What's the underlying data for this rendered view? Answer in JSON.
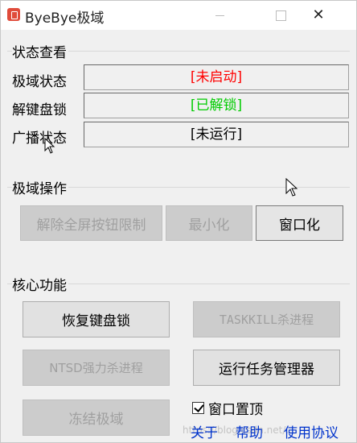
{
  "window": {
    "title": "ByeBye极域",
    "close_glyph": "✕"
  },
  "status_group": {
    "title": "状态查看",
    "rows": [
      {
        "label": "极域状态",
        "value": "[未启动]",
        "color": "#ff0000"
      },
      {
        "label": "解键盘锁",
        "value": "[已解锁]",
        "color": "#00cc00"
      },
      {
        "label": "广播状态",
        "value": "[未运行]",
        "color": "#000000"
      }
    ]
  },
  "ops_group": {
    "title": "极域操作",
    "buttons": [
      {
        "label": "解除全屏按钮限制",
        "enabled": false
      },
      {
        "label": "最小化",
        "enabled": false
      },
      {
        "label": "窗口化",
        "enabled": true
      }
    ]
  },
  "core_group": {
    "title": "核心功能",
    "buttons": [
      {
        "label": "恢复键盘锁",
        "enabled": true
      },
      {
        "label": "TASKKILL杀进程",
        "enabled": false
      },
      {
        "label": "NTSD强力杀进程",
        "enabled": false
      },
      {
        "label": "运行任务管理器",
        "enabled": true
      },
      {
        "label": "冻结极域",
        "enabled": false
      }
    ],
    "topmost_checkbox": {
      "label": "窗口置顶",
      "checked": true
    }
  },
  "links": {
    "about": "关于",
    "help": "帮助",
    "agreement": "使用协议"
  },
  "watermark": "https://blog.csdn.net/..."
}
